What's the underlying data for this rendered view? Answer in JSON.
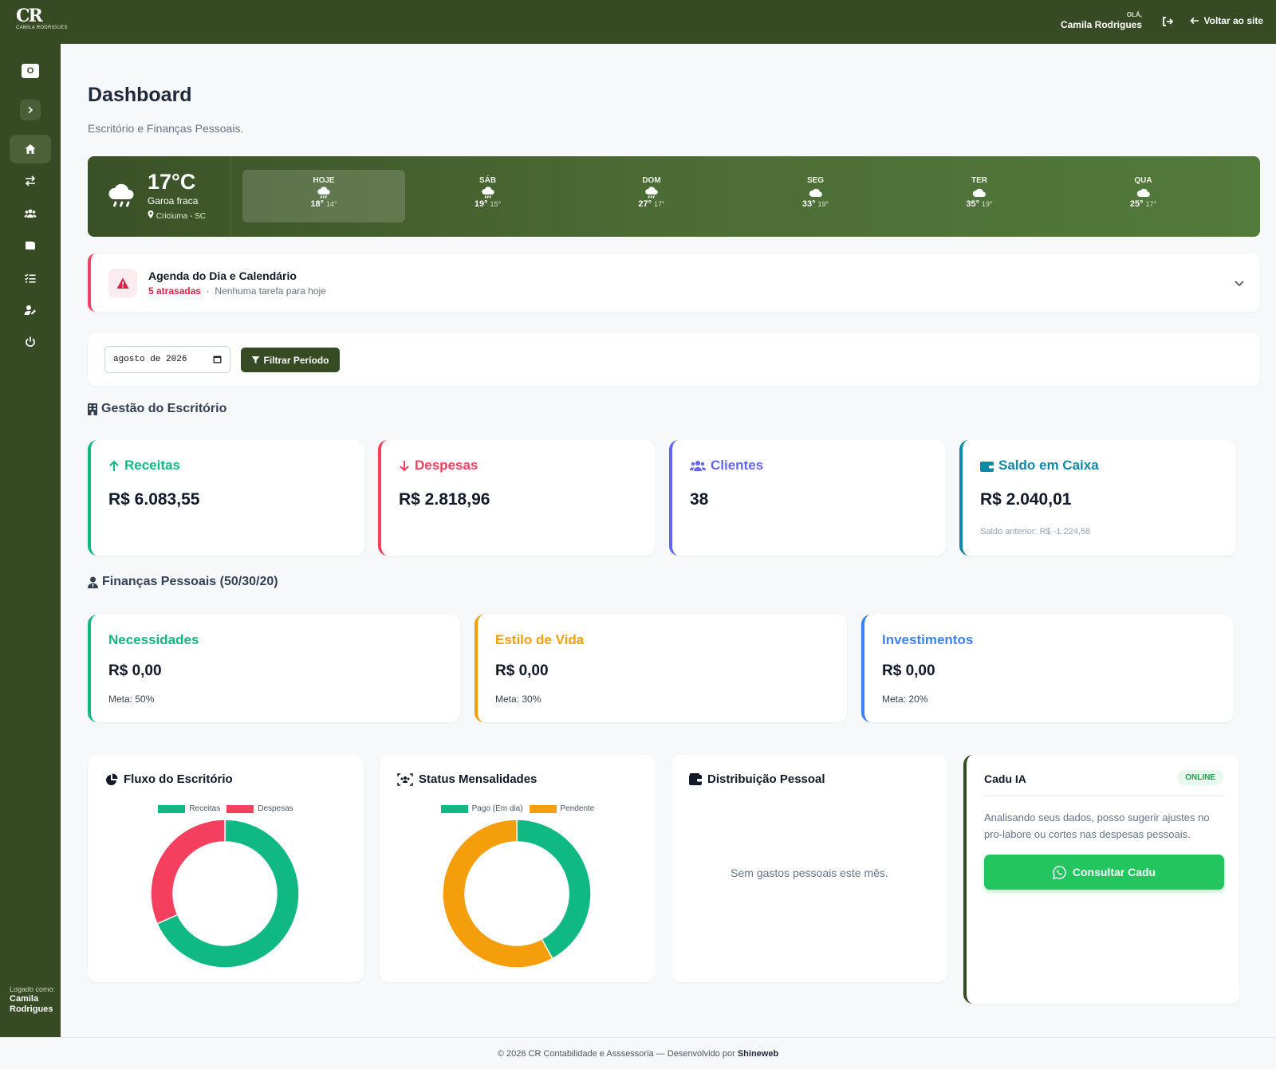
{
  "header": {
    "logo_mark": "CR",
    "logo_sub": "CAMILA RODRIGUES",
    "greeting": "OLÁ,",
    "user_name": "Camila Rodrigues",
    "back_label": "Voltar ao site"
  },
  "sidebar": {
    "logo_text": "O",
    "items": [
      {
        "name": "home-icon",
        "active": true
      },
      {
        "name": "transfer-icon",
        "active": false
      },
      {
        "name": "users-icon",
        "active": false
      },
      {
        "name": "wallet-icon",
        "active": false
      },
      {
        "name": "tasks-icon",
        "active": false
      },
      {
        "name": "user-edit-icon",
        "active": false
      },
      {
        "name": "power-icon",
        "active": false
      }
    ],
    "logged_label": "Logado como:",
    "logged_user": "Camila Rodrigues"
  },
  "page": {
    "title": "Dashboard",
    "subtitle": "Escritório e Finanças Pessoais."
  },
  "weather": {
    "temp": "17°C",
    "description": "Garoa fraca",
    "location": "Criciuma - SC",
    "days": [
      {
        "name": "HOJE",
        "icon": "rain",
        "max": "18°",
        "min": "14°"
      },
      {
        "name": "SÁB",
        "icon": "rain",
        "max": "19°",
        "min": "15°"
      },
      {
        "name": "DOM",
        "icon": "rain",
        "max": "27°",
        "min": "17°"
      },
      {
        "name": "SEG",
        "icon": "cloud",
        "max": "33°",
        "min": "19°"
      },
      {
        "name": "TER",
        "icon": "cloud",
        "max": "35°",
        "min": "19°"
      },
      {
        "name": "QUA",
        "icon": "cloud",
        "max": "25°",
        "min": "17°"
      }
    ]
  },
  "agenda": {
    "title": "Agenda do Dia e Calendário",
    "late": "5 atrasadas",
    "separator": "·",
    "today": "Nenhuma tarefa para hoje"
  },
  "filter": {
    "date_value": "agosto de 2026",
    "button_label": "Filtrar Período"
  },
  "office": {
    "section_title": "Gestão do Escritório",
    "cards": [
      {
        "title": "Receitas",
        "value": "R$ 6.083,55",
        "note": "",
        "color": "#10b981"
      },
      {
        "title": "Despesas",
        "value": "R$ 2.818,96",
        "note": "",
        "color": "#f43f5e"
      },
      {
        "title": "Clientes",
        "value": "38",
        "note": "",
        "color": "#6366f1"
      },
      {
        "title": "Saldo em Caixa",
        "value": "R$ 2.040,01",
        "note": "Saldo anterior: R$ -1.224,58",
        "color": "#0e8aa8"
      }
    ]
  },
  "personal": {
    "section_title": "Finanças Pessoais (50/30/20)",
    "cards": [
      {
        "title": "Necessidades",
        "value": "R$ 0,00",
        "meta": "Meta: 50%",
        "color": "#10b981"
      },
      {
        "title": "Estilo de Vida",
        "value": "R$ 0,00",
        "meta": "Meta: 30%",
        "color": "#f59e0b"
      },
      {
        "title": "Investimentos",
        "value": "R$ 0,00",
        "meta": "Meta: 20%",
        "color": "#3b82f6"
      }
    ]
  },
  "charts": {
    "fluxo_title": "Fluxo do Escritório",
    "status_title": "Status Mensalidades",
    "dist_title": "Distribuição Pessoal",
    "dist_empty": "Sem gastos pessoais este mês."
  },
  "chart_data": [
    {
      "type": "pie",
      "title": "Fluxo do Escritório",
      "labels": [
        "Receitas",
        "Despesas"
      ],
      "values": [
        6083.55,
        2818.96
      ],
      "colors": [
        "#10b981",
        "#f43f5e"
      ],
      "legend": "top"
    },
    {
      "type": "pie",
      "title": "Status Mensalidades",
      "labels": [
        "Pago (Em dia)",
        "Pendente"
      ],
      "values": [
        42,
        58
      ],
      "colors": [
        "#10b981",
        "#f59e0b"
      ],
      "legend": "top"
    }
  ],
  "ai": {
    "title": "Cadu IA",
    "badge": "ONLINE",
    "text": "Analisando seus dados, posso sugerir ajustes no pro-labore ou cortes nas despesas pessoais.",
    "button_label": "Consultar Cadu"
  },
  "footer": {
    "text": "© 2026 CR Contabilidade e Asssessoria — Desenvolvido por",
    "brand": "Shineweb"
  }
}
